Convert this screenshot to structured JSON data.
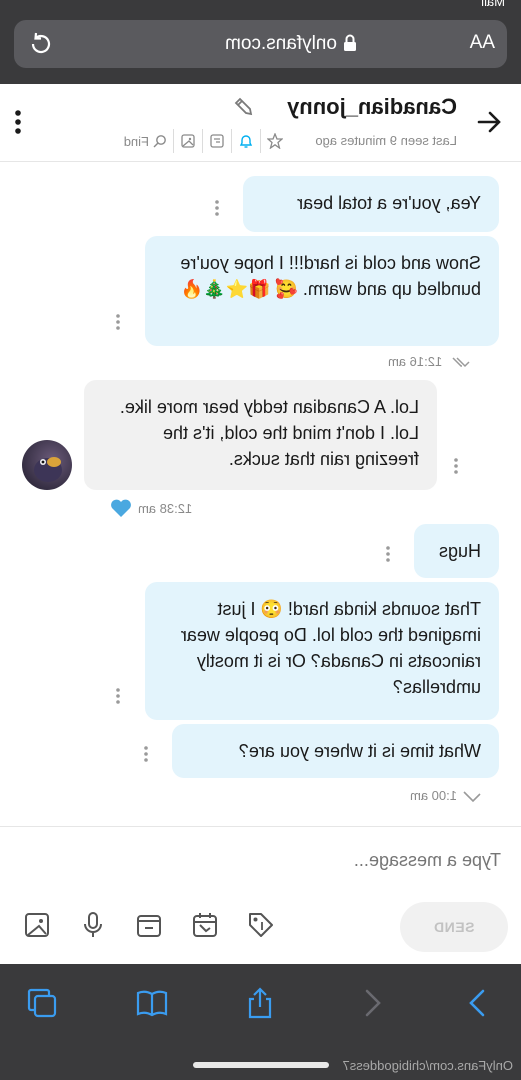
{
  "browser": {
    "status": "Mail",
    "text_size_label": "AA",
    "url": "onlyfans.com"
  },
  "header": {
    "name": "Canadian_jonny",
    "last_seen": "Last seen 9 minutes ago",
    "find_label": "Find"
  },
  "messages": [
    {
      "text": "Yea, you're a total bear"
    },
    {
      "text": "Snow and cold is hard!!! I hope you're bundled up and warm. 🥰 🎁⭐🎄🔥",
      "time": "12:16 am"
    },
    {
      "text": "Lol. A Canadian teddy bear more like. Lol. I don't mind the cold, it's the freezing rain that sucks.",
      "time": "12:38 am"
    },
    {
      "text": "Hugs"
    },
    {
      "text": "That sounds kinda hard! 😳 I just imagined the cold lol. Do people wear raincoats in Canada? Or is it mostly umbrellas?"
    },
    {
      "text": "What time is it where you are?",
      "time": "1:00 am"
    }
  ],
  "composer": {
    "placeholder": "Type a message...",
    "send_label": "SEND"
  },
  "caption": "OnlyFans.com/chibigoddess7",
  "colors": {
    "incoming_bubble": "#e3f4fc",
    "outgoing_bubble": "#f1f1f1",
    "accent": "#00aff0",
    "heart": "#4aa8e0"
  }
}
